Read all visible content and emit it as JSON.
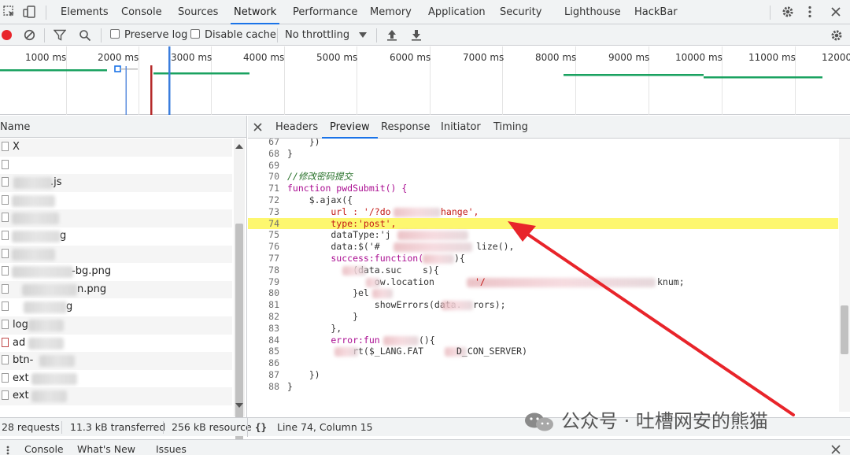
{
  "tabs": [
    "Elements",
    "Console",
    "Sources",
    "Network",
    "Performance",
    "Memory",
    "Application",
    "Security",
    "Lighthouse",
    "HackBar"
  ],
  "active_tab": "Network",
  "toolbar": {
    "preserve_log": "Preserve log",
    "disable_cache": "Disable cache",
    "throttling": "No throttling"
  },
  "overview": {
    "labels": [
      "1000 ms",
      "2000 ms",
      "3000 ms",
      "4000 ms",
      "5000 ms",
      "6000 ms",
      "7000 ms",
      "8000 ms",
      "9000 ms",
      "10000 ms",
      "11000 ms",
      "12000"
    ]
  },
  "name_pane": {
    "header": "Name",
    "rows": [
      "X",
      "",
      ".js",
      "",
      "",
      "g",
      "",
      "-bg.png",
      "n.png",
      "g",
      "log",
      "ad",
      "btn-",
      "ext",
      "ext"
    ]
  },
  "detail_tabs": [
    "Headers",
    "Preview",
    "Response",
    "Initiator",
    "Timing"
  ],
  "active_detail_tab": "Preview",
  "code": {
    "lines": [
      {
        "n": "67",
        "t": "    })"
      },
      {
        "n": "68",
        "t": "}"
      },
      {
        "n": "69",
        "t": ""
      },
      {
        "n": "70",
        "t": "//修改密码提交"
      },
      {
        "n": "71",
        "t": "function pwdSubmit() {"
      },
      {
        "n": "72",
        "t": "    $.ajax({"
      },
      {
        "n": "73",
        "t": "        url : '/?do"
      },
      {
        "n": "74",
        "t": "        type:'post',"
      },
      {
        "n": "75",
        "t": "        dataType:'j"
      },
      {
        "n": "76",
        "t": "        data:$('#"
      },
      {
        "n": "77",
        "t": "        success:function("
      },
      {
        "n": "78",
        "t": "            (data.suc"
      },
      {
        "n": "79",
        "t": "                ow.location"
      },
      {
        "n": "80",
        "t": "            }el"
      },
      {
        "n": "81",
        "t": "                showErrors(data."
      },
      {
        "n": "82",
        "t": "            }"
      },
      {
        "n": "83",
        "t": "        },"
      },
      {
        "n": "84",
        "t": "        error:fun"
      },
      {
        "n": "85",
        "t": "            rt($_LANG.FAT"
      },
      {
        "n": "86",
        "t": "        "
      },
      {
        "n": "87",
        "t": "    })"
      },
      {
        "n": "88",
        "t": "}"
      }
    ],
    "fragments": {
      "l73b": "hange',",
      "l76b": "lize(),",
      "l77b": "){",
      "l78b": "s){",
      "l79b": "'/",
      "l79c": "knum;",
      "l81b": "rors);",
      "l84b": "(){",
      "l85b": "D_CON_SERVER)"
    }
  },
  "status": {
    "requests": "28 requests",
    "transferred": "11.3 kB transferred",
    "resources": "256 kB resource",
    "cursor": "Line 74, Column 15",
    "braces": "{}"
  },
  "drawer": [
    "Console",
    "What's New",
    "Issues"
  ],
  "watermark": "公众号 · 吐槽网安的熊猫",
  "colors": {
    "accent": "#1a73e8",
    "highlight": "#fdf76f",
    "arrow": "#e8242a",
    "record": "#e8242a",
    "waterfall": "#1aa260"
  }
}
